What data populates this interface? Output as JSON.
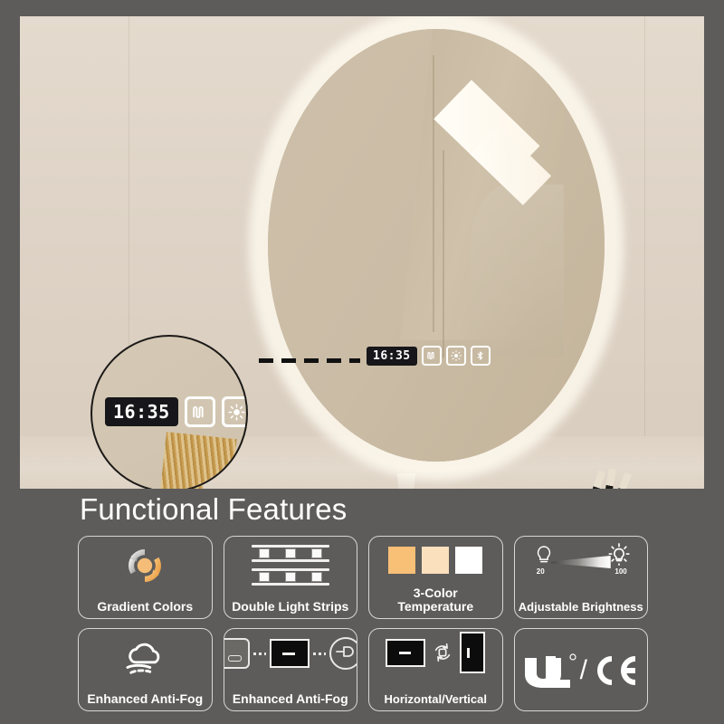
{
  "scene": {
    "mirror": {
      "panel": {
        "time": "16:35",
        "buttons": [
          {
            "name": "defogger-button",
            "icon": "defogger-icon"
          },
          {
            "name": "light-button",
            "icon": "light-bulb-icon"
          },
          {
            "name": "bluetooth-button",
            "icon": "bluetooth-icon"
          }
        ]
      }
    },
    "callout": {
      "time": "16:35",
      "buttons": [
        {
          "name": "defogger-button",
          "icon": "defogger-icon"
        },
        {
          "name": "light-button",
          "icon": "light-bulb-icon"
        },
        {
          "name": "bluetooth-button",
          "icon": "bluetooth-icon"
        }
      ]
    }
  },
  "features": {
    "title": "Functional Features",
    "cards": [
      {
        "label": "Gradient Colors",
        "icon": "gradient-colors-icon"
      },
      {
        "label": "Double Light Strips",
        "icon": "double-light-strips-icon"
      },
      {
        "label": "3-Color\nTemperature",
        "icon": "color-temperature-icon",
        "line1": "3-Color",
        "line2": "Temperature",
        "swatches": [
          "#f8bf77",
          "#fbe0bd",
          "#ffffff"
        ]
      },
      {
        "label": "Adjustable Brightness",
        "icon": "adjustable-brightness-icon",
        "min": "20",
        "max": "100"
      },
      {
        "label": "Enhanced Anti-Fog",
        "icon": "anti-fog-cloud-icon"
      },
      {
        "label": "Enhanced Anti-Fog",
        "icon": "anti-fog-wiring-icon"
      },
      {
        "label": "Horizontal/Vertical",
        "icon": "orientation-icon"
      },
      {
        "label": "UL / CE",
        "icon": "ul-ce-certification-icon",
        "ul": "UL",
        "ce": "CE",
        "sep": "/"
      }
    ]
  },
  "colors": {
    "frame": "#5d5c5a",
    "photo_bg": "#ded3c6",
    "mirror": "#c9bba4",
    "accent_warm": "#f8bf77",
    "text": "#ffffff"
  }
}
